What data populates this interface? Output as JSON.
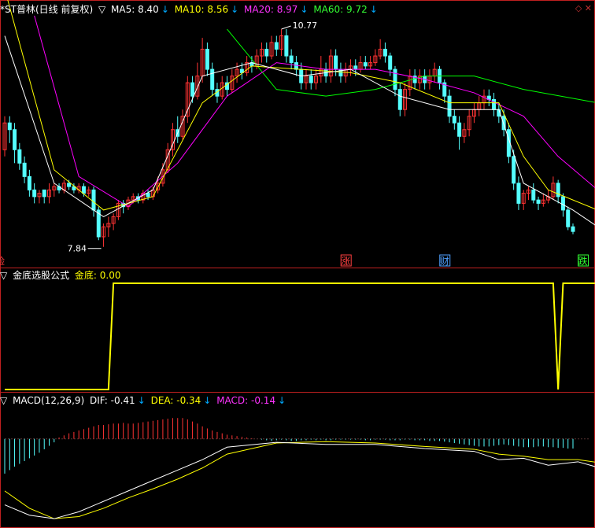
{
  "colors": {
    "background": "#000000",
    "border": "#c02020",
    "up": "#ff3333",
    "down": "#54ffff",
    "ma5": "#ffffff",
    "ma10": "#ffff00",
    "ma20": "#ff00ff",
    "ma60": "#00ff00",
    "signal": "#ffff00",
    "dif": "#ffffff",
    "dea": "#ffff00",
    "macd": "#ff33ff",
    "arrow": "#00aaff"
  },
  "panels": {
    "main": {
      "prefix": "*ST普林(日线 前复权)",
      "indicators": [
        {
          "label": "MA5: 8.40",
          "color": "#ffffff"
        },
        {
          "label": "MA10: 8.56",
          "color": "#ffff00"
        },
        {
          "label": "MA20: 8.97",
          "color": "#ff33ff"
        },
        {
          "label": "MA60: 9.72",
          "color": "#33ff33"
        }
      ]
    },
    "signal": {
      "title": "金底选股公式",
      "value": "金底: 0.00"
    },
    "macd": {
      "title": "MACD(12,26,9)",
      "indicators": [
        {
          "label": "DIF: -0.41",
          "color": "#ffffff"
        },
        {
          "label": "DEA: -0.34",
          "color": "#ffff00"
        },
        {
          "label": "MACD: -0.14",
          "color": "#ff33ff"
        }
      ]
    }
  },
  "annotations": {
    "high": "10.77",
    "low": "7.84",
    "markers": [
      {
        "text": "涨",
        "index": 69,
        "color": "#ff4040"
      },
      {
        "text": "财",
        "index": 89,
        "color": "#4fa0ff"
      },
      {
        "text": "跌",
        "index": 117,
        "color": "#33ff33"
      }
    ],
    "left_marker": "险"
  },
  "chart_data": {
    "type": "candlestick",
    "price_range": [
      7.6,
      11.1
    ],
    "candles": [
      [
        9.1,
        9.5,
        9.6,
        9.0
      ],
      [
        9.5,
        9.4,
        9.6,
        9.2
      ],
      [
        9.4,
        9.1,
        9.5,
        8.9
      ],
      [
        9.1,
        8.9,
        9.2,
        8.8
      ],
      [
        8.9,
        8.7,
        9.0,
        8.6
      ],
      [
        8.7,
        8.5,
        8.8,
        8.4
      ],
      [
        8.5,
        8.4,
        8.6,
        8.3
      ],
      [
        8.4,
        8.45,
        8.5,
        8.3
      ],
      [
        8.5,
        8.4,
        8.5,
        8.3
      ],
      [
        8.4,
        8.5,
        8.6,
        8.3
      ],
      [
        8.5,
        8.55,
        8.6,
        8.4
      ],
      [
        8.55,
        8.5,
        8.6,
        8.45
      ],
      [
        8.5,
        8.6,
        8.65,
        8.45
      ],
      [
        8.6,
        8.55,
        8.65,
        8.5
      ],
      [
        8.55,
        8.5,
        8.6,
        8.45
      ],
      [
        8.5,
        8.55,
        8.6,
        8.45
      ],
      [
        8.55,
        8.45,
        8.6,
        8.4
      ],
      [
        8.45,
        8.5,
        8.55,
        8.4
      ],
      [
        8.5,
        8.2,
        8.55,
        8.1
      ],
      [
        8.2,
        7.8,
        8.25,
        7.75
      ],
      [
        7.8,
        7.95,
        8.0,
        7.65
      ],
      [
        7.95,
        8.0,
        8.1,
        7.8
      ],
      [
        8.0,
        8.1,
        8.15,
        7.9
      ],
      [
        8.1,
        8.3,
        8.35,
        8.05
      ],
      [
        8.3,
        8.25,
        8.35,
        8.15
      ],
      [
        8.25,
        8.35,
        8.4,
        8.2
      ],
      [
        8.35,
        8.4,
        8.45,
        8.3
      ],
      [
        8.4,
        8.35,
        8.45,
        8.3
      ],
      [
        8.35,
        8.45,
        8.5,
        8.3
      ],
      [
        8.45,
        8.4,
        8.5,
        8.35
      ],
      [
        8.4,
        8.5,
        8.55,
        8.35
      ],
      [
        8.5,
        8.6,
        8.7,
        8.45
      ],
      [
        8.6,
        8.8,
        8.9,
        8.55
      ],
      [
        8.8,
        9.1,
        9.2,
        8.75
      ],
      [
        9.1,
        9.4,
        9.5,
        9.0
      ],
      [
        9.4,
        9.3,
        9.6,
        9.2
      ],
      [
        9.3,
        9.6,
        9.7,
        9.25
      ],
      [
        9.6,
        10.1,
        10.2,
        9.5
      ],
      [
        10.1,
        9.9,
        10.2,
        9.8
      ],
      [
        9.9,
        10.2,
        10.4,
        9.85
      ],
      [
        10.2,
        10.6,
        10.77,
        10.1
      ],
      [
        10.6,
        10.3,
        10.7,
        10.2
      ],
      [
        10.3,
        10.0,
        10.4,
        9.9
      ],
      [
        10.0,
        9.9,
        10.1,
        9.8
      ],
      [
        9.9,
        10.1,
        10.2,
        9.85
      ],
      [
        10.1,
        10.0,
        10.2,
        9.9
      ],
      [
        10.0,
        10.2,
        10.3,
        9.95
      ],
      [
        10.2,
        10.3,
        10.4,
        10.1
      ],
      [
        10.3,
        10.25,
        10.4,
        10.15
      ],
      [
        10.25,
        10.4,
        10.5,
        10.2
      ],
      [
        10.4,
        10.35,
        10.5,
        10.25
      ],
      [
        10.35,
        10.5,
        10.6,
        10.3
      ],
      [
        10.5,
        10.6,
        10.7,
        10.4
      ],
      [
        10.6,
        10.5,
        10.7,
        10.4
      ],
      [
        10.5,
        10.7,
        10.8,
        10.45
      ],
      [
        10.7,
        10.6,
        10.8,
        10.5
      ],
      [
        10.6,
        10.8,
        10.9,
        10.5
      ],
      [
        10.8,
        10.5,
        10.9,
        10.4
      ],
      [
        10.5,
        10.4,
        10.6,
        10.3
      ],
      [
        10.4,
        10.3,
        10.5,
        10.2
      ],
      [
        10.3,
        10.1,
        10.4,
        10.0
      ],
      [
        10.1,
        10.2,
        10.3,
        10.0
      ],
      [
        10.2,
        10.1,
        10.3,
        10.0
      ],
      [
        10.1,
        10.2,
        10.3,
        10.0
      ],
      [
        10.2,
        10.3,
        10.5,
        10.1
      ],
      [
        10.3,
        10.2,
        10.4,
        10.1
      ],
      [
        10.2,
        10.5,
        10.6,
        10.1
      ],
      [
        10.5,
        10.3,
        10.6,
        10.2
      ],
      [
        10.3,
        10.2,
        10.4,
        10.1
      ],
      [
        10.2,
        10.3,
        10.4,
        10.1
      ],
      [
        10.3,
        10.35,
        10.45,
        10.2
      ],
      [
        10.35,
        10.3,
        10.45,
        10.2
      ],
      [
        10.3,
        10.4,
        10.5,
        10.25
      ],
      [
        10.4,
        10.35,
        10.5,
        10.3
      ],
      [
        10.35,
        10.4,
        10.5,
        10.3
      ],
      [
        10.4,
        10.5,
        10.6,
        10.35
      ],
      [
        10.5,
        10.6,
        10.75,
        10.45
      ],
      [
        10.6,
        10.5,
        10.7,
        10.4
      ],
      [
        10.5,
        10.3,
        10.55,
        10.2
      ],
      [
        10.3,
        10.0,
        10.35,
        9.9
      ],
      [
        10.0,
        9.7,
        10.1,
        9.6
      ],
      [
        9.7,
        10.0,
        10.1,
        9.6
      ],
      [
        10.0,
        10.2,
        10.3,
        9.9
      ],
      [
        10.2,
        10.1,
        10.3,
        10.0
      ],
      [
        10.1,
        10.2,
        10.3,
        10.0
      ],
      [
        10.2,
        10.1,
        10.3,
        10.0
      ],
      [
        10.1,
        10.2,
        10.3,
        10.0
      ],
      [
        10.2,
        10.3,
        10.4,
        10.1
      ],
      [
        10.3,
        10.1,
        10.35,
        10.0
      ],
      [
        10.1,
        9.9,
        10.15,
        9.8
      ],
      [
        9.9,
        9.6,
        10.0,
        9.5
      ],
      [
        9.6,
        9.5,
        9.7,
        9.4
      ],
      [
        9.5,
        9.3,
        9.6,
        9.1
      ],
      [
        9.3,
        9.4,
        9.5,
        9.2
      ],
      [
        9.4,
        9.6,
        9.7,
        9.3
      ],
      [
        9.6,
        9.7,
        9.8,
        9.5
      ],
      [
        9.7,
        9.8,
        9.9,
        9.6
      ],
      [
        9.8,
        9.9,
        10.0,
        9.7
      ],
      [
        9.9,
        9.85,
        10.0,
        9.75
      ],
      [
        9.85,
        9.7,
        9.95,
        9.6
      ],
      [
        9.7,
        9.6,
        9.8,
        9.5
      ],
      [
        9.6,
        9.4,
        9.7,
        9.3
      ],
      [
        9.4,
        9.0,
        9.5,
        8.9
      ],
      [
        9.0,
        8.6,
        9.1,
        8.5
      ],
      [
        8.6,
        8.3,
        8.7,
        8.2
      ],
      [
        8.3,
        8.45,
        8.5,
        8.2
      ],
      [
        8.45,
        8.5,
        8.55,
        8.35
      ],
      [
        8.5,
        8.35,
        8.6,
        8.3
      ],
      [
        8.35,
        8.3,
        8.4,
        8.2
      ],
      [
        8.3,
        8.35,
        8.45,
        8.25
      ],
      [
        8.35,
        8.4,
        8.5,
        8.3
      ],
      [
        8.4,
        8.6,
        8.7,
        8.35
      ],
      [
        8.6,
        8.4,
        8.65,
        8.3
      ],
      [
        8.4,
        8.2,
        8.45,
        8.1
      ],
      [
        8.2,
        7.95,
        8.25,
        7.9
      ],
      [
        7.95,
        7.88,
        8.0,
        7.84
      ]
    ],
    "ma": {
      "MA5": [
        [
          0,
          10.8
        ],
        [
          10,
          8.6
        ],
        [
          20,
          8.1
        ],
        [
          30,
          8.5
        ],
        [
          40,
          10.2
        ],
        [
          50,
          10.4
        ],
        [
          60,
          10.2
        ],
        [
          70,
          10.3
        ],
        [
          80,
          9.9
        ],
        [
          90,
          9.7
        ],
        [
          100,
          9.7
        ],
        [
          105,
          8.6
        ],
        [
          110,
          8.4
        ],
        [
          115,
          8.2
        ],
        [
          120,
          7.95
        ]
      ],
      "MA10": [
        [
          0,
          11.5
        ],
        [
          10,
          8.8
        ],
        [
          20,
          8.2
        ],
        [
          30,
          8.4
        ],
        [
          40,
          9.8
        ],
        [
          50,
          10.35
        ],
        [
          60,
          10.3
        ],
        [
          70,
          10.25
        ],
        [
          80,
          10.1
        ],
        [
          90,
          9.8
        ],
        [
          100,
          9.8
        ],
        [
          105,
          9.0
        ],
        [
          110,
          8.5
        ],
        [
          115,
          8.35
        ],
        [
          120,
          8.2
        ]
      ],
      "MA20": [
        [
          6,
          11.1
        ],
        [
          15,
          8.7
        ],
        [
          25,
          8.25
        ],
        [
          35,
          8.9
        ],
        [
          45,
          9.9
        ],
        [
          55,
          10.4
        ],
        [
          65,
          10.3
        ],
        [
          75,
          10.3
        ],
        [
          85,
          10.15
        ],
        [
          95,
          9.95
        ],
        [
          105,
          9.6
        ],
        [
          112,
          9.0
        ],
        [
          120,
          8.5
        ]
      ],
      "MA60": [
        [
          45,
          10.9
        ],
        [
          55,
          10.0
        ],
        [
          65,
          9.9
        ],
        [
          75,
          10.0
        ],
        [
          85,
          10.2
        ],
        [
          95,
          10.2
        ],
        [
          105,
          10.0
        ],
        [
          120,
          9.8
        ]
      ]
    },
    "signal": {
      "title": "金底选股公式",
      "steps": [
        [
          0,
          0
        ],
        [
          21,
          0
        ],
        [
          22,
          1
        ],
        [
          111,
          1
        ],
        [
          112,
          0
        ],
        [
          113,
          1
        ],
        [
          120,
          1
        ]
      ]
    },
    "macd": {
      "hist": [
        -0.5,
        -0.45,
        -0.4,
        -0.36,
        -0.32,
        -0.28,
        -0.24,
        -0.2,
        -0.15,
        -0.1,
        -0.05,
        0.02,
        0.05,
        0.08,
        0.1,
        0.12,
        0.14,
        0.16,
        0.18,
        0.2,
        0.2,
        0.21,
        0.22,
        0.22,
        0.23,
        0.22,
        0.22,
        0.23,
        0.24,
        0.25,
        0.26,
        0.27,
        0.28,
        0.29,
        0.3,
        0.3,
        0.3,
        0.28,
        0.25,
        0.22,
        0.18,
        0.15,
        0.12,
        0.1,
        0.08,
        0.06,
        0.05,
        0.04,
        0.03,
        0.02,
        0.01,
        0.0,
        -0.01,
        -0.02,
        -0.03,
        -0.02,
        -0.01,
        -0.02,
        -0.03,
        -0.03,
        -0.02,
        -0.02,
        -0.01,
        -0.02,
        -0.01,
        -0.02,
        -0.02,
        -0.01,
        -0.01,
        -0.01,
        -0.01,
        -0.01,
        -0.01,
        -0.02,
        -0.02,
        -0.01,
        -0.01,
        -0.01,
        -0.02,
        -0.02,
        -0.02,
        -0.01,
        -0.01,
        -0.02,
        -0.02,
        -0.02,
        -0.03,
        -0.03,
        -0.03,
        -0.04,
        -0.05,
        -0.06,
        -0.07,
        -0.08,
        -0.09,
        -0.1,
        -0.11,
        -0.11,
        -0.11,
        -0.1,
        -0.09,
        -0.08,
        -0.09,
        -0.1,
        -0.11,
        -0.12,
        -0.12,
        -0.12,
        -0.11,
        -0.11,
        -0.12,
        -0.12,
        -0.13,
        -0.13,
        -0.14,
        -0.14
      ],
      "dif": [
        [
          0,
          -0.95
        ],
        [
          5,
          -1.1
        ],
        [
          10,
          -1.15
        ],
        [
          15,
          -1.05
        ],
        [
          20,
          -0.9
        ],
        [
          25,
          -0.75
        ],
        [
          30,
          -0.6
        ],
        [
          35,
          -0.45
        ],
        [
          40,
          -0.3
        ],
        [
          45,
          -0.12
        ],
        [
          55,
          -0.05
        ],
        [
          65,
          -0.08
        ],
        [
          75,
          -0.08
        ],
        [
          85,
          -0.14
        ],
        [
          95,
          -0.18
        ],
        [
          100,
          -0.3
        ],
        [
          105,
          -0.28
        ],
        [
          110,
          -0.38
        ],
        [
          116,
          -0.33
        ],
        [
          120,
          -0.41
        ]
      ],
      "dea": [
        [
          0,
          -0.75
        ],
        [
          5,
          -1.0
        ],
        [
          10,
          -1.15
        ],
        [
          15,
          -1.12
        ],
        [
          20,
          -1.0
        ],
        [
          25,
          -0.85
        ],
        [
          30,
          -0.72
        ],
        [
          35,
          -0.58
        ],
        [
          40,
          -0.42
        ],
        [
          45,
          -0.22
        ],
        [
          55,
          -0.06
        ],
        [
          65,
          -0.04
        ],
        [
          75,
          -0.06
        ],
        [
          85,
          -0.11
        ],
        [
          95,
          -0.15
        ],
        [
          100,
          -0.22
        ],
        [
          105,
          -0.25
        ],
        [
          110,
          -0.3
        ],
        [
          116,
          -0.3
        ],
        [
          120,
          -0.34
        ]
      ],
      "range": [
        -1.25,
        0.45
      ]
    }
  }
}
